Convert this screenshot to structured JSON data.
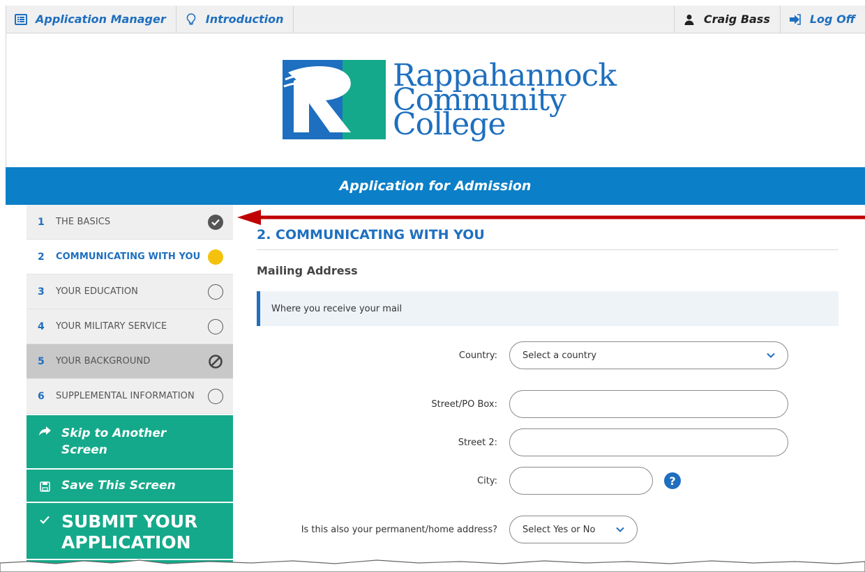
{
  "topbar": {
    "app_manager": "Application Manager",
    "introduction": "Introduction",
    "user": "Craig Bass",
    "logoff": "Log Off"
  },
  "logo": {
    "line1": "Rappahannock",
    "line2": "Community",
    "line3": "College",
    "colors": {
      "blue": "#1e6fbf",
      "green": "#14a98a"
    }
  },
  "banner": {
    "title": "Application for Admission"
  },
  "sidebar": {
    "steps": [
      {
        "num": "1",
        "label": "The Basics",
        "status": "complete"
      },
      {
        "num": "2",
        "label": "Communicating With You",
        "status": "current"
      },
      {
        "num": "3",
        "label": "Your Education",
        "status": "not-started"
      },
      {
        "num": "4",
        "label": "Your Military Service",
        "status": "not-started"
      },
      {
        "num": "5",
        "label": "Your Background",
        "status": "disabled"
      },
      {
        "num": "6",
        "label": "Supplemental Information",
        "status": "not-started"
      }
    ],
    "actions": {
      "skip": "Skip to Another Screen",
      "save": "Save This Screen",
      "submit": "Submit Your Application"
    }
  },
  "main": {
    "section_title": "2. COMMUNICATING WITH YOU",
    "sub_title": "Mailing Address",
    "note": "Where you receive your mail",
    "fields": {
      "country_label": "Country:",
      "country_value": "Select a country",
      "street_label": "Street/PO Box:",
      "street_value": "",
      "street2_label": "Street 2:",
      "street2_value": "",
      "city_label": "City:",
      "city_value": "",
      "permanent_label": "Is this also your permanent/home address?",
      "permanent_value": "Select Yes or No"
    }
  },
  "colors": {
    "accent": "#0b7fc7",
    "green": "#14a98a",
    "current": "#f4c20d",
    "arrow": "#c00000"
  }
}
